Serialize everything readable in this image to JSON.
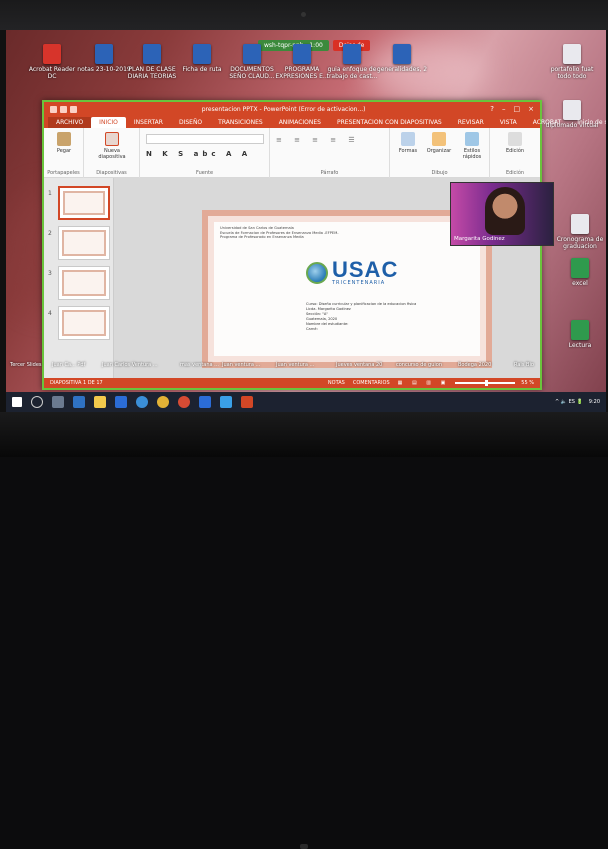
{
  "meet_bar": {
    "call_info": "wsh-tqpr-nnh · 1:00",
    "stop_label": "Dejar de"
  },
  "desktop_icons": [
    {
      "label": "Acrobat Reader DC",
      "color": "red"
    },
    {
      "label": "notas 23-10-2019",
      "color": "blue"
    },
    {
      "label": "PLAN DE CLASE DIARIA TEORIAS",
      "color": "blue"
    },
    {
      "label": "Ficha de ruta",
      "color": "blue"
    },
    {
      "label": "DOCUMENTOS SEÑO CLAUD...",
      "color": "blue"
    },
    {
      "label": "PROGRAMA EXPRESIONES E...",
      "color": "blue"
    },
    {
      "label": "guia enfoque de trabajo de cast...",
      "color": "blue"
    },
    {
      "label": "generalidades, 2",
      "color": "blue"
    }
  ],
  "right_icons": [
    {
      "label": "portafolio fuat todo todo"
    },
    {
      "label": "diplomado virtual"
    },
    {
      "label": "Cronograma de graduacion"
    },
    {
      "label": "excel"
    },
    {
      "label": "Lectura"
    }
  ],
  "ppt": {
    "title": "presentacion PPTX - PowerPoint (Error de activacion...)",
    "window_controls": [
      "?",
      "–",
      "□",
      "×"
    ],
    "tabs": [
      "ARCHIVO",
      "INICIO",
      "INSERTAR",
      "DISEÑO",
      "TRANSICIONES",
      "ANIMACIONES",
      "PRESENTACION CON DIAPOSITIVAS",
      "REVISAR",
      "VISTA",
      "ACROBAT"
    ],
    "active_tab": "INICIO",
    "user": "Inicio de sesión",
    "ribbon_groups": [
      "Portapapeles",
      "Diapositivas",
      "Fuente",
      "Párrafo",
      "Dibujo",
      "Edición"
    ],
    "buttons": {
      "paste": "Pegar",
      "new_slide": "Nueva diapositiva",
      "shapes": "Formas",
      "arrange": "Organizar",
      "quick_styles": "Estilos rápidos",
      "editing": "Edición"
    },
    "slide": {
      "header_lines": [
        "Universidad de San Carlos de Guatemala",
        "Escuela de Formacion de Profesores de Ensenanza Media -EFPEM-",
        "Programa de Profesorado en Ensenanza Media"
      ],
      "logo_text": "USAC",
      "logo_sub": "TRICENTENARIA",
      "body_lines": [
        "Curso: Diseño curricular y planificacion de la educacion fisica",
        "Licda. Margarita Godinez",
        "Sección: \"A\"",
        "Guatemala, 2020",
        "Nombre del estudiante:",
        "Carné:"
      ]
    },
    "status": {
      "slide_info": "DIAPOSITIVA 1 DE 17",
      "notes": "NOTAS",
      "comments": "COMENTARIOS",
      "zoom": "55 %"
    },
    "thumbnails": [
      "1",
      "2",
      "3",
      "4"
    ]
  },
  "video_tile": {
    "name": "Margarita Godinez"
  },
  "taskbar": {
    "tray": "^ 🔈 ES 🔋",
    "time": "9:20"
  },
  "bottom_labels": [
    "Tercer Slides",
    "Juan Ca... Pdf",
    "Juan Carlos Ventura ...",
    "mas ventana ...",
    "Juan ventura ...",
    "Juan ventura ...",
    "Jueves ventana 20",
    "concurso de guion",
    "Bodega 2020",
    "Rais Bio"
  ],
  "colors": {
    "ppt_accent": "#d24726",
    "window_border": "#6ac43c"
  }
}
